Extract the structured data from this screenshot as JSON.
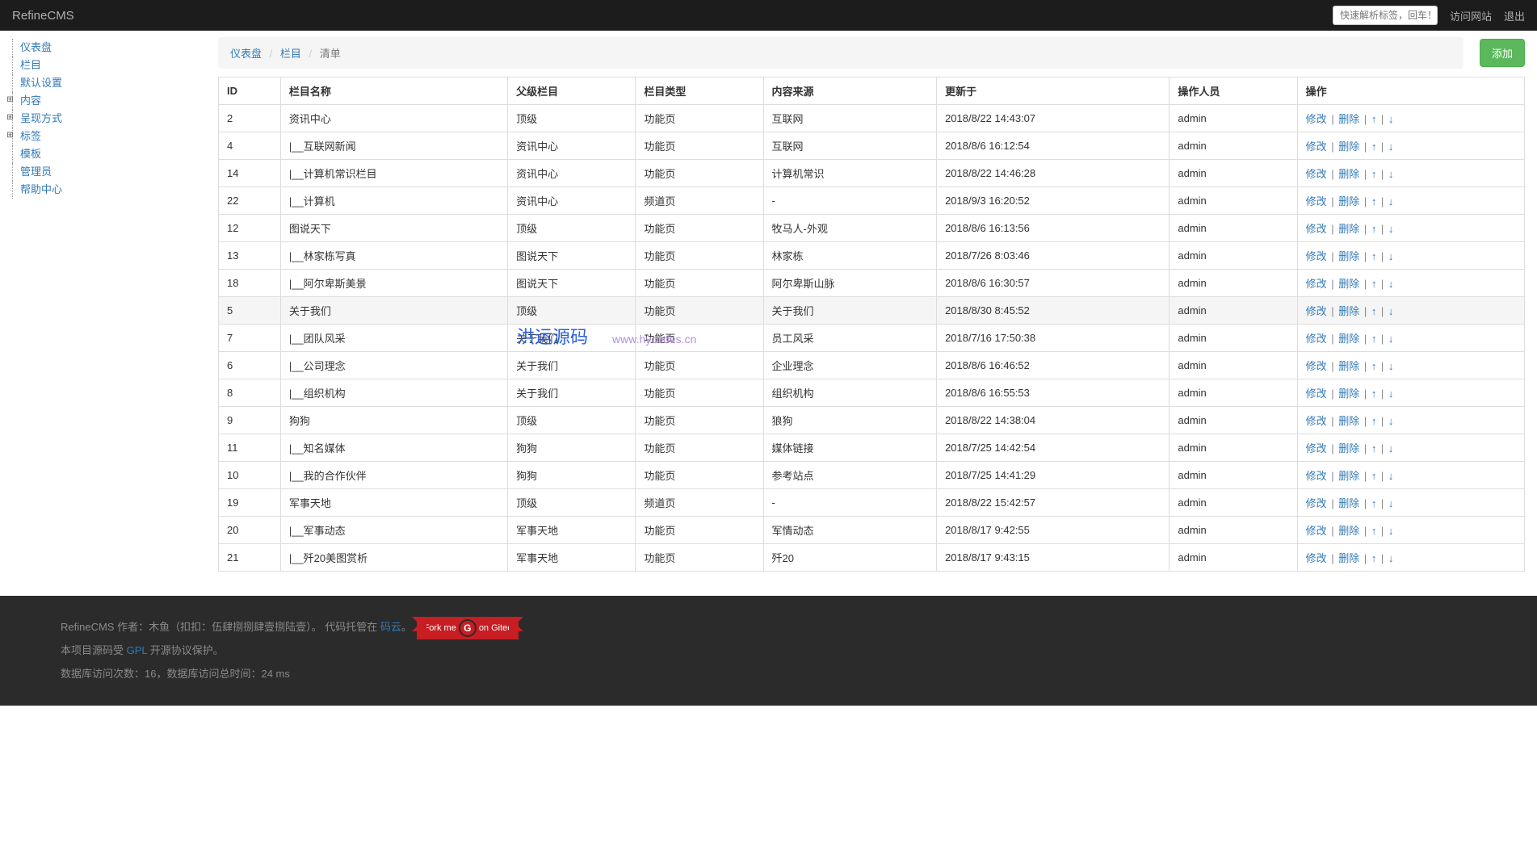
{
  "navbar": {
    "brand": "RefineCMS",
    "search_placeholder": "快速解析标签，回车！",
    "visit_site": "访问网站",
    "logout": "退出"
  },
  "sidebar": {
    "items": [
      {
        "label": "仪表盘",
        "expandable": false
      },
      {
        "label": "栏目",
        "expandable": false
      },
      {
        "label": "默认设置",
        "expandable": false
      },
      {
        "label": "内容",
        "expandable": true
      },
      {
        "label": "呈现方式",
        "expandable": true
      },
      {
        "label": "标签",
        "expandable": true
      },
      {
        "label": "模板",
        "expandable": false
      },
      {
        "label": "管理员",
        "expandable": false
      },
      {
        "label": "帮助中心",
        "expandable": false
      }
    ]
  },
  "breadcrumb": {
    "items": [
      "仪表盘",
      "栏目",
      "清单"
    ]
  },
  "buttons": {
    "add": "添加"
  },
  "table": {
    "headers": [
      "ID",
      "栏目名称",
      "父级栏目",
      "栏目类型",
      "内容来源",
      "更新于",
      "操作人员",
      "操作"
    ],
    "action_labels": {
      "edit": "修改",
      "delete": "删除",
      "up": "↑",
      "down": "↓"
    },
    "rows": [
      {
        "id": "2",
        "name": "资讯中心",
        "parent": "顶级",
        "type": "功能页",
        "source": "互联网",
        "updated": "2018/8/22 14:43:07",
        "user": "admin"
      },
      {
        "id": "4",
        "name": "|__互联网新闻",
        "parent": "资讯中心",
        "type": "功能页",
        "source": "互联网",
        "updated": "2018/8/6 16:12:54",
        "user": "admin"
      },
      {
        "id": "14",
        "name": "|__计算机常识栏目",
        "parent": "资讯中心",
        "type": "功能页",
        "source": "计算机常识",
        "updated": "2018/8/22 14:46:28",
        "user": "admin"
      },
      {
        "id": "22",
        "name": "|__计算机",
        "parent": "资讯中心",
        "type": "频道页",
        "source": "-",
        "updated": "2018/9/3 16:20:52",
        "user": "admin"
      },
      {
        "id": "12",
        "name": "图说天下",
        "parent": "顶级",
        "type": "功能页",
        "source": "牧马人-外观",
        "updated": "2018/8/6 16:13:56",
        "user": "admin"
      },
      {
        "id": "13",
        "name": "|__林家栋写真",
        "parent": "图说天下",
        "type": "功能页",
        "source": "林家栋",
        "updated": "2018/7/26 8:03:46",
        "user": "admin"
      },
      {
        "id": "18",
        "name": "|__阿尔卑斯美景",
        "parent": "图说天下",
        "type": "功能页",
        "source": "阿尔卑斯山脉",
        "updated": "2018/8/6 16:30:57",
        "user": "admin"
      },
      {
        "id": "5",
        "name": "关于我们",
        "parent": "顶级",
        "type": "功能页",
        "source": "关于我们",
        "updated": "2018/8/30 8:45:52",
        "user": "admin",
        "hover": true
      },
      {
        "id": "7",
        "name": "|__团队风采",
        "parent": "关于我们",
        "type": "功能页",
        "source": "员工风采",
        "updated": "2018/7/16 17:50:38",
        "user": "admin"
      },
      {
        "id": "6",
        "name": "|__公司理念",
        "parent": "关于我们",
        "type": "功能页",
        "source": "企业理念",
        "updated": "2018/8/6 16:46:52",
        "user": "admin"
      },
      {
        "id": "8",
        "name": "|__组织机构",
        "parent": "关于我们",
        "type": "功能页",
        "source": "组织机构",
        "updated": "2018/8/6 16:55:53",
        "user": "admin"
      },
      {
        "id": "9",
        "name": "狗狗",
        "parent": "顶级",
        "type": "功能页",
        "source": "狼狗",
        "updated": "2018/8/22 14:38:04",
        "user": "admin"
      },
      {
        "id": "11",
        "name": "|__知名媒体",
        "parent": "狗狗",
        "type": "功能页",
        "source": "媒体链接",
        "updated": "2018/7/25 14:42:54",
        "user": "admin"
      },
      {
        "id": "10",
        "name": "|__我的合作伙伴",
        "parent": "狗狗",
        "type": "功能页",
        "source": "参考站点",
        "updated": "2018/7/25 14:41:29",
        "user": "admin"
      },
      {
        "id": "19",
        "name": "军事天地",
        "parent": "顶级",
        "type": "频道页",
        "source": "-",
        "updated": "2018/8/22 15:42:57",
        "user": "admin"
      },
      {
        "id": "20",
        "name": "|__军事动态",
        "parent": "军事天地",
        "type": "功能页",
        "source": "军情动态",
        "updated": "2018/8/17 9:42:55",
        "user": "admin"
      },
      {
        "id": "21",
        "name": "|__歼20美图赏析",
        "parent": "军事天地",
        "type": "功能页",
        "source": "歼20",
        "updated": "2018/8/17 9:43:15",
        "user": "admin"
      }
    ]
  },
  "footer": {
    "line1_prefix": "RefineCMS 作者：木鱼（扣扣：伍肆捌捌肆壹捌陆壹）。 代码托管在 ",
    "gitee_link": "码云",
    "period": "。",
    "fork_me": "Fork me",
    "on_gitee": "on Gitee",
    "line2_prefix": "本项目源码受 ",
    "gpl": "GPL",
    "line2_suffix": " 开源协议保护。",
    "line3": "数据库访问次数：16，数据库访问总时间：24 ms"
  },
  "watermark": {
    "text": "洪运源码",
    "url": "www.hycodes.cn"
  }
}
